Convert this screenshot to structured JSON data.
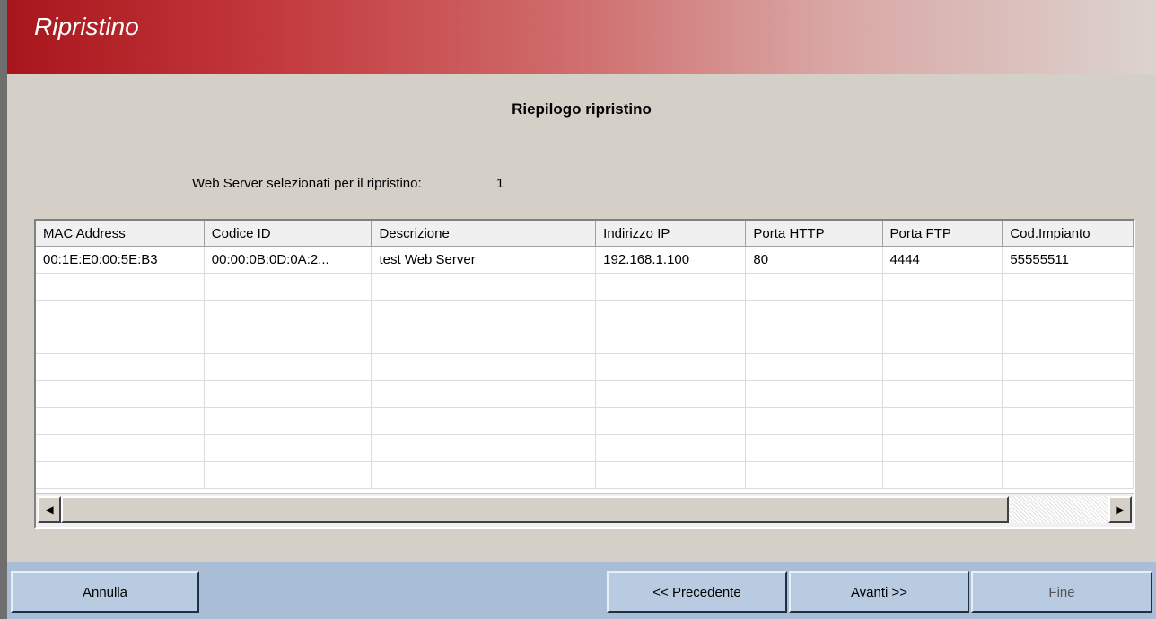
{
  "window": {
    "title": "Ripristino"
  },
  "summary": {
    "heading": "Riepilogo ripristino",
    "count_label": "Web Server selezionati per il ripristino:",
    "count_value": "1"
  },
  "table": {
    "columns": [
      "MAC Address",
      "Codice ID",
      "Descrizione",
      "Indirizzo IP",
      "Porta HTTP",
      "Porta FTP",
      "Cod.Impianto"
    ],
    "rows": [
      [
        "00:1E:E0:00:5E:B3",
        "00:00:0B:0D:0A:2...",
        "test Web Server",
        "192.168.1.100",
        "80",
        "4444",
        "55555511"
      ]
    ]
  },
  "scrollbar": {
    "left_icon": "arrow-left-icon",
    "right_icon": "arrow-right-icon"
  },
  "buttons": {
    "cancel": "Annulla",
    "back": "<< Precedente",
    "next": "Avanti >>",
    "finish": "Fine"
  },
  "colors": {
    "title_red": "#a8161c",
    "footer_blue": "#a9bdd6"
  }
}
